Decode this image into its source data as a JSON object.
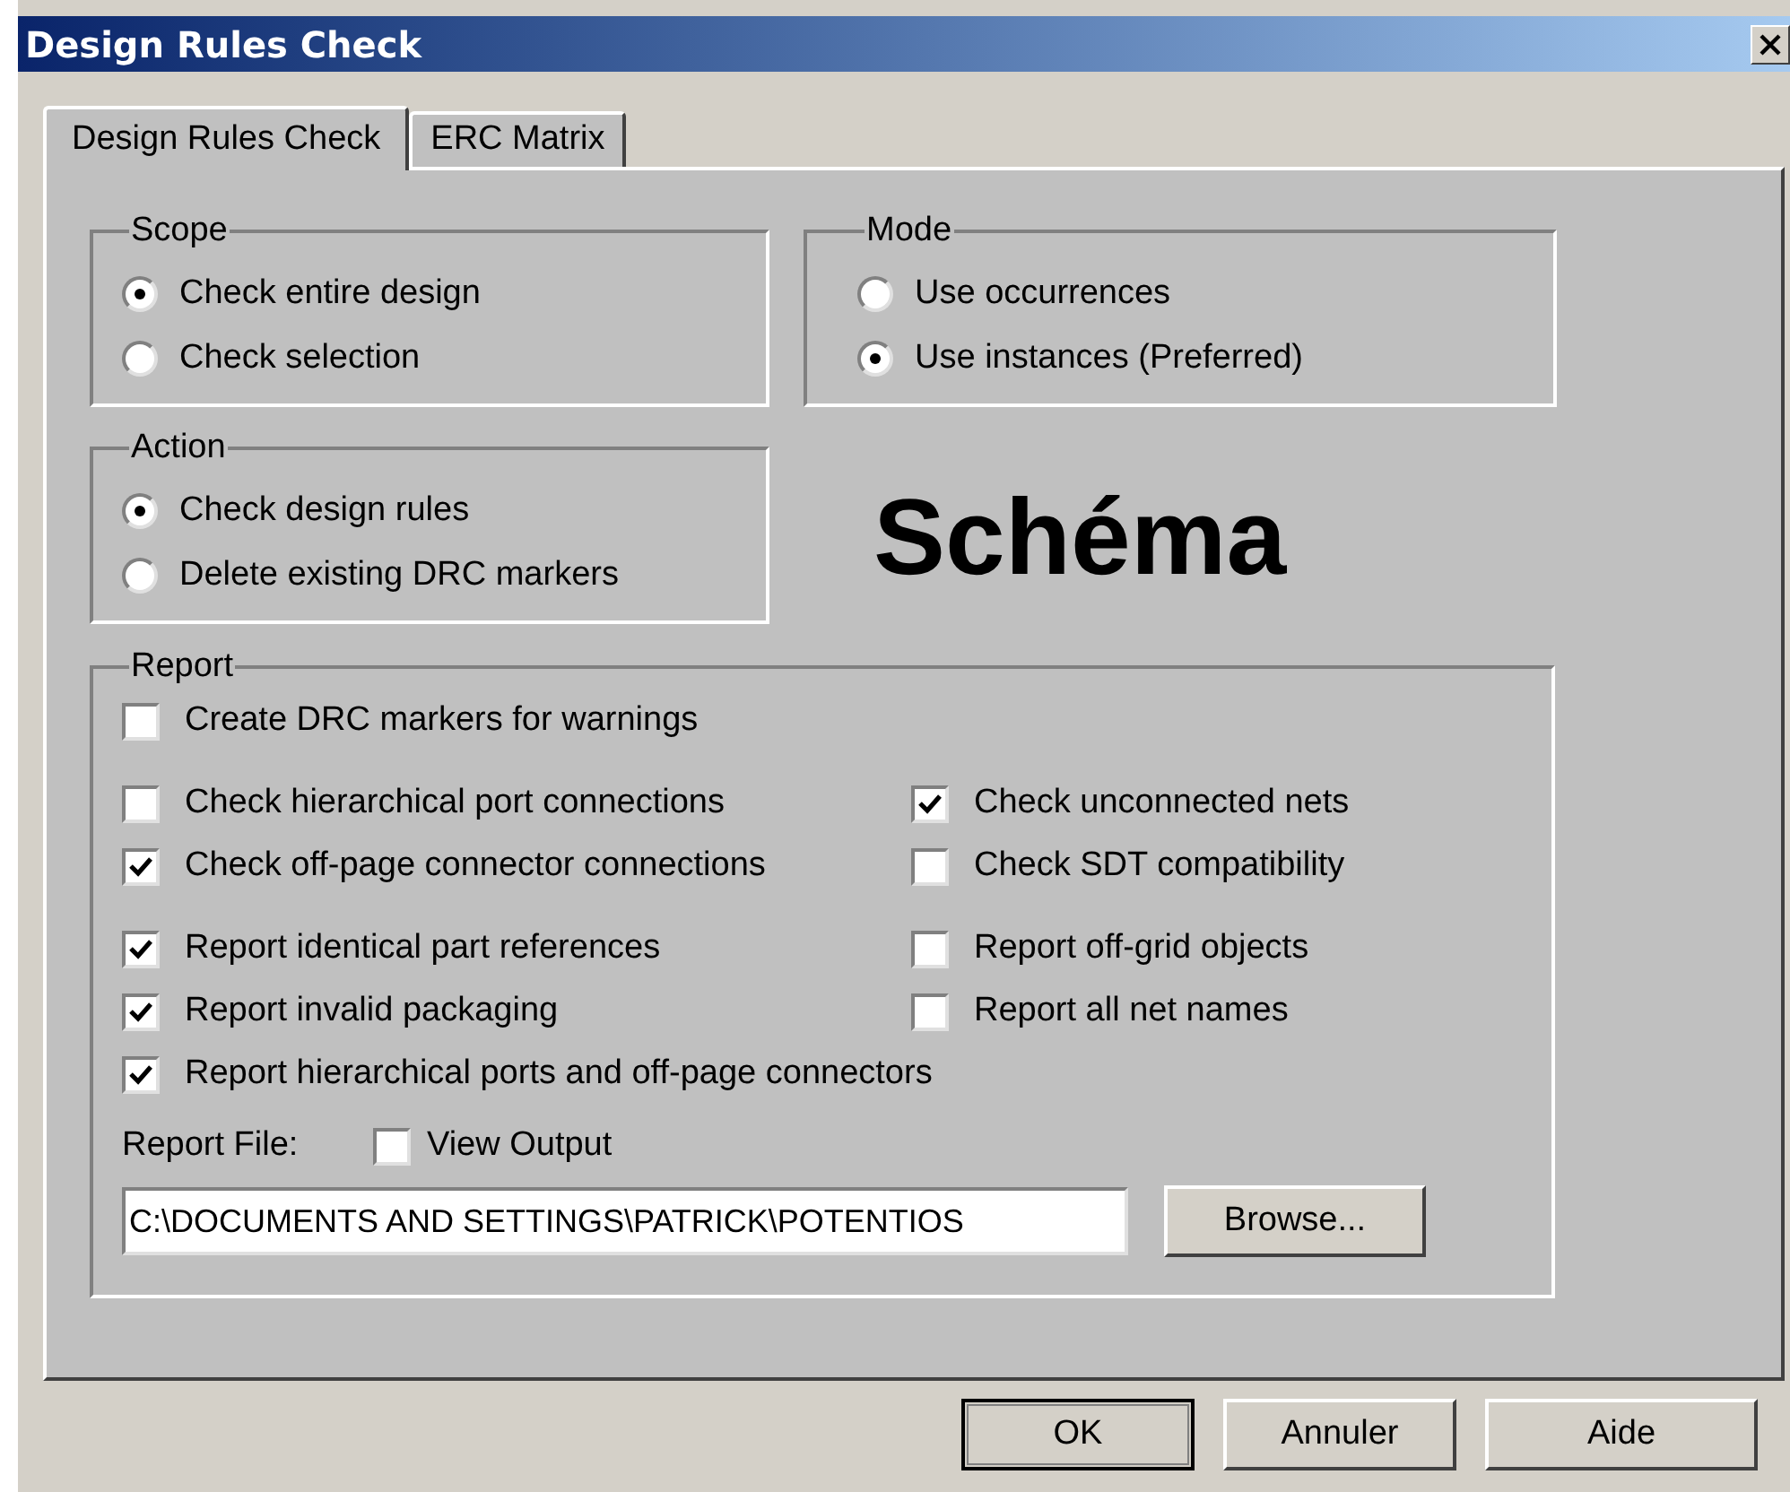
{
  "window": {
    "title": "Design Rules Check"
  },
  "tabs": [
    {
      "label": "Design Rules Check",
      "selected": true
    },
    {
      "label": "ERC Matrix",
      "selected": false
    }
  ],
  "scope": {
    "label": "Scope",
    "options": [
      {
        "label": "Check entire design",
        "selected": true
      },
      {
        "label": "Check selection",
        "selected": false
      }
    ]
  },
  "mode": {
    "label": "Mode",
    "options": [
      {
        "label": "Use occurrences",
        "selected": false
      },
      {
        "label": "Use instances (Preferred)",
        "selected": true
      }
    ]
  },
  "action": {
    "label": "Action",
    "options": [
      {
        "label": "Check design rules",
        "selected": true
      },
      {
        "label": "Delete existing DRC markers",
        "selected": false
      }
    ]
  },
  "overlay_label": "Schéma",
  "report": {
    "label": "Report",
    "sections": [
      {
        "rows": [
          [
            {
              "label": "Create DRC markers for warnings",
              "checked": false
            }
          ]
        ]
      },
      {
        "rows": [
          [
            {
              "label": "Check hierarchical port connections",
              "checked": false
            },
            {
              "label": "Check unconnected nets",
              "checked": true
            }
          ],
          [
            {
              "label": "Check off-page connector connections",
              "checked": true
            },
            {
              "label": "Check SDT compatibility",
              "checked": false
            }
          ]
        ]
      },
      {
        "rows": [
          [
            {
              "label": "Report identical part references",
              "checked": true
            },
            {
              "label": "Report off-grid objects",
              "checked": false
            }
          ],
          [
            {
              "label": "Report invalid packaging",
              "checked": true
            },
            {
              "label": "Report all net names",
              "checked": false
            }
          ],
          [
            {
              "label": "Report hierarchical ports and off-page connectors",
              "checked": true
            }
          ]
        ]
      }
    ],
    "file_label": "Report File:",
    "view_output": {
      "label": "View Output",
      "checked": false
    },
    "file_path": "C:\\DOCUMENTS AND SETTINGS\\PATRICK\\POTENTIOS",
    "browse": "Browse..."
  },
  "buttons": [
    {
      "label": "OK",
      "default": true
    },
    {
      "label": "Annuler",
      "default": false
    },
    {
      "label": "Aide",
      "default": false
    }
  ]
}
